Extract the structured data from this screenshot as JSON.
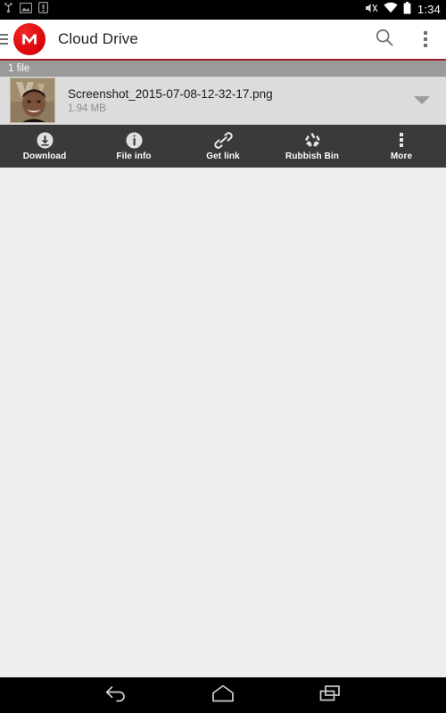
{
  "statusbar": {
    "time": "1:34",
    "left_icons": [
      {
        "name": "usb-debugging-icon"
      },
      {
        "name": "screenshot-captured-icon"
      },
      {
        "name": "sim-card-alert-icon"
      }
    ],
    "right_icons": [
      {
        "name": "volume-muted-icon"
      },
      {
        "name": "wifi-icon"
      },
      {
        "name": "battery-icon"
      }
    ]
  },
  "appbar": {
    "menu_icon": "hamburger-menu-icon",
    "logo_letter": "M",
    "title": "Cloud Drive",
    "search_icon": "search-icon",
    "overflow_icon": "overflow-menu-icon",
    "accent_color": "#e00d0d",
    "rule_color": "#9d2026"
  },
  "list": {
    "count_label": "1 file",
    "count_bar_color": "#9a9a9a",
    "selected_row_color": "#dcdcdc",
    "items": [
      {
        "name": "Screenshot_2015-07-08-12-32-17.png",
        "size": "1.94 MB",
        "thumbnail": "photo-thumbnail",
        "caret": "chevron-down-icon",
        "selected": true
      }
    ]
  },
  "actionbar": {
    "background": "#3a3a3a",
    "items": [
      {
        "label": "Download",
        "icon": "download-circle-icon"
      },
      {
        "label": "File info",
        "icon": "info-circle-icon"
      },
      {
        "label": "Get link",
        "icon": "link-chain-icon"
      },
      {
        "label": "Rubbish Bin",
        "icon": "recycle-bin-icon"
      },
      {
        "label": "More",
        "icon": "overflow-menu-icon"
      }
    ]
  },
  "content": {
    "background": "#eeeeee"
  },
  "navbar": {
    "buttons": [
      {
        "name": "back-button",
        "icon": "back-arrow-icon"
      },
      {
        "name": "home-button",
        "icon": "home-icon"
      },
      {
        "name": "recents-button",
        "icon": "recents-icon"
      }
    ]
  }
}
